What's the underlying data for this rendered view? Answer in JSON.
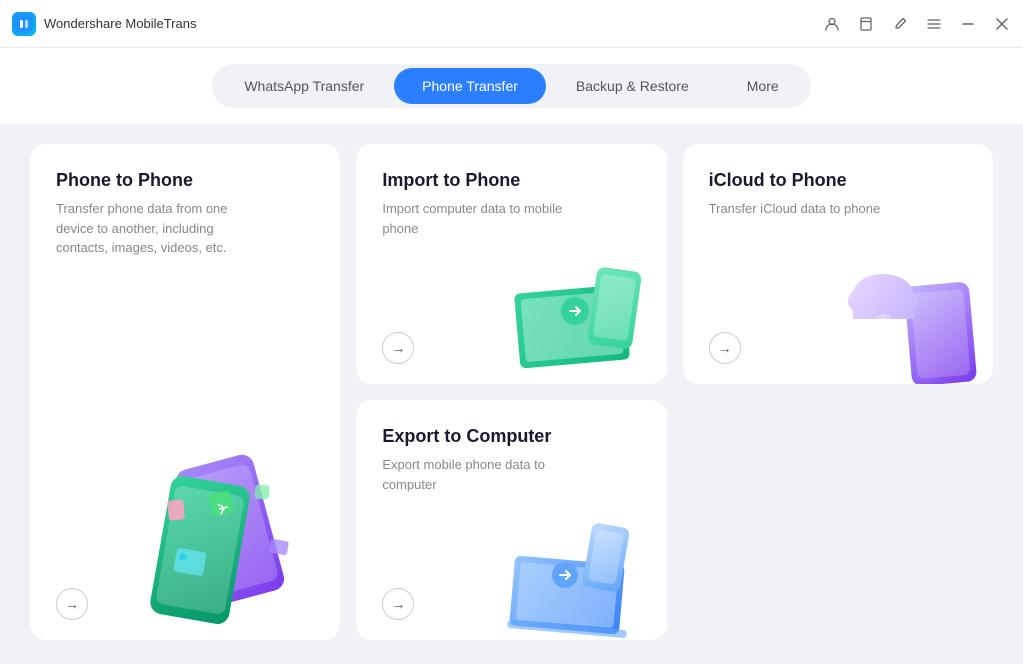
{
  "app": {
    "icon_text": "W",
    "title": "Wondershare MobileTrans"
  },
  "window_controls": {
    "account_icon": "👤",
    "bookmark_icon": "🔖",
    "edit_icon": "✏️",
    "menu_icon": "☰",
    "minimize_icon": "—",
    "close_icon": "✕"
  },
  "nav": {
    "tabs": [
      {
        "id": "whatsapp",
        "label": "WhatsApp Transfer",
        "active": false
      },
      {
        "id": "phone",
        "label": "Phone Transfer",
        "active": true
      },
      {
        "id": "backup",
        "label": "Backup & Restore",
        "active": false
      },
      {
        "id": "more",
        "label": "More",
        "active": false
      }
    ]
  },
  "cards": {
    "phone_to_phone": {
      "title": "Phone to Phone",
      "desc": "Transfer phone data from one device to another, including contacts, images, videos, etc.",
      "arrow": "→"
    },
    "import_to_phone": {
      "title": "Import to Phone",
      "desc": "Import computer data to mobile phone",
      "arrow": "→"
    },
    "icloud_to_phone": {
      "title": "iCloud to Phone",
      "desc": "Transfer iCloud data to phone",
      "arrow": "→"
    },
    "export_to_computer": {
      "title": "Export to Computer",
      "desc": "Export mobile phone data to computer",
      "arrow": "→"
    }
  }
}
